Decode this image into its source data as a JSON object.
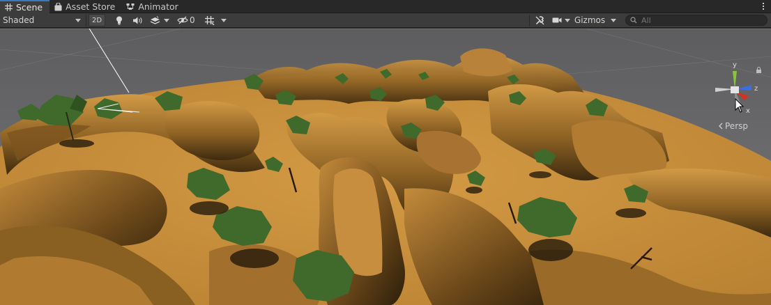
{
  "tabs": [
    {
      "label": "Scene",
      "icon": "grid-icon",
      "active": true
    },
    {
      "label": "Asset Store",
      "icon": "shopping-bag-icon",
      "active": false
    },
    {
      "label": "Animator",
      "icon": "animator-icon",
      "active": false
    }
  ],
  "toolbar": {
    "draw_mode": "Shaded",
    "mode_2d": "2D",
    "hidden_count": "0",
    "gizmos_label": "Gizmos",
    "search_placeholder": "All"
  },
  "view": {
    "projection_label": "Persp",
    "axis_x": "x",
    "axis_y": "y",
    "axis_z": "z"
  },
  "colors": {
    "terrain": "#c99440",
    "sky": "#6e6e70",
    "tree": "#3f6a2c",
    "axis_x": "#d5321e",
    "axis_y": "#8cc43c",
    "axis_z": "#3b6ee0"
  }
}
